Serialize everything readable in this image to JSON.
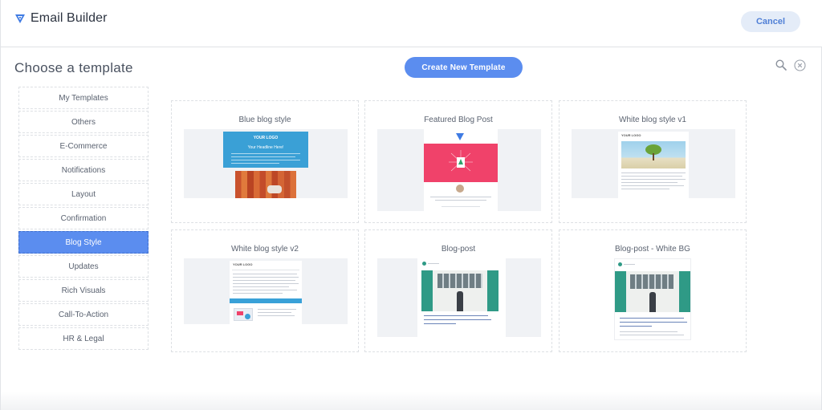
{
  "header": {
    "title": "Email Builder",
    "cancel_label": "Cancel"
  },
  "main": {
    "title": "Choose a template",
    "create_label": "Create New Template"
  },
  "sidebar": {
    "items": [
      {
        "label": "My Templates"
      },
      {
        "label": "Others"
      },
      {
        "label": "E-Commerce"
      },
      {
        "label": "Notifications"
      },
      {
        "label": "Layout"
      },
      {
        "label": "Confirmation"
      },
      {
        "label": "Blog Style",
        "active": true
      },
      {
        "label": "Updates"
      },
      {
        "label": "Rich Visuals"
      },
      {
        "label": "Call-To-Action"
      },
      {
        "label": "HR & Legal"
      }
    ]
  },
  "templates": [
    {
      "title": "Blue blog style",
      "logo": "YOUR LOGO",
      "headline": "Your Headline Here!"
    },
    {
      "title": "Featured Blog Post"
    },
    {
      "title": "White blog style v1",
      "logo": "YOUR LOGO"
    },
    {
      "title": "White blog style v2",
      "logo": "YOUR LOGO"
    },
    {
      "title": "Blog-post"
    },
    {
      "title": "Blog-post - White BG"
    }
  ],
  "colors": {
    "accent": "#5b8def",
    "cancel_bg": "#e4ecf8",
    "blue_header": "#3aa0d6",
    "pink_header": "#f0426a",
    "garage_door": "#2f9a86"
  },
  "icons": {
    "brand": "brand-logo-icon",
    "search": "search-icon",
    "close": "close-circle-icon"
  }
}
